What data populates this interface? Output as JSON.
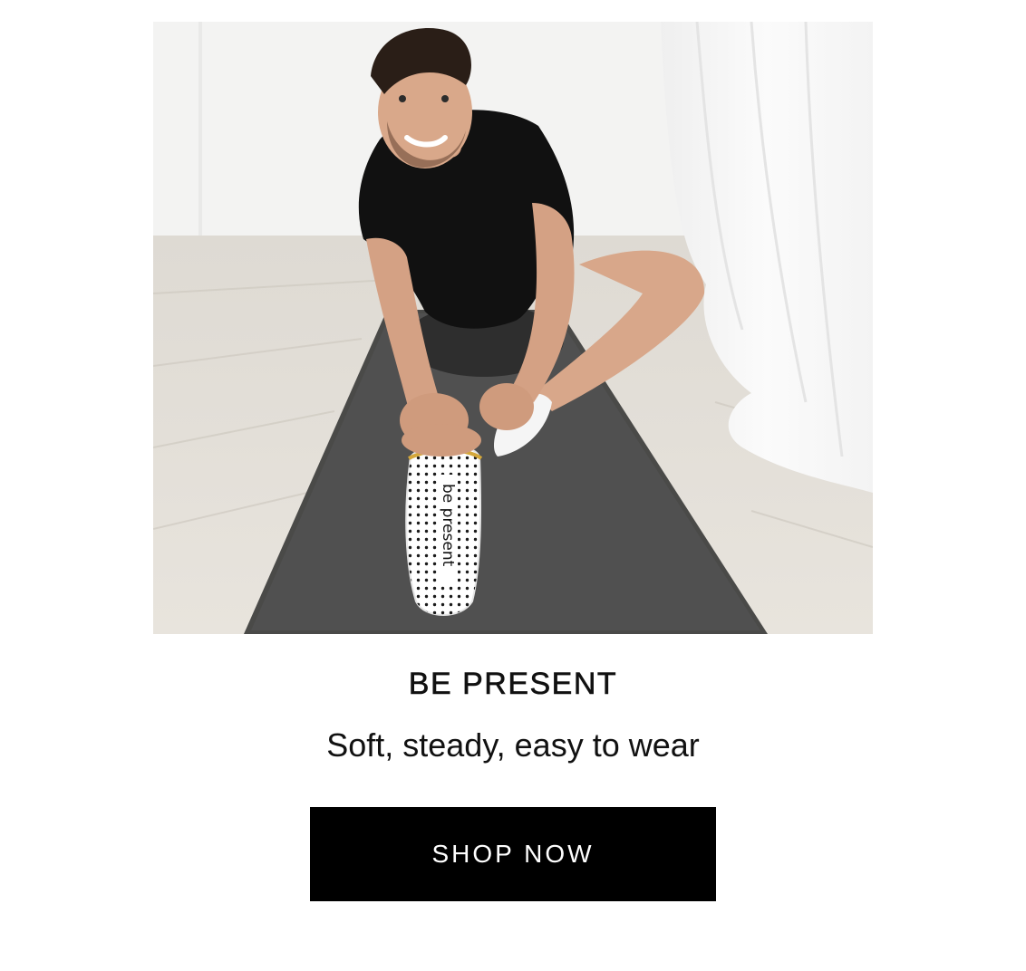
{
  "hero": {
    "sock_print": "be present"
  },
  "promo": {
    "headline": "BE PRESENT",
    "subheadline": "Soft, steady, easy to wear",
    "cta_label": "SHOP NOW"
  },
  "colors": {
    "cta_background": "#000000",
    "cta_text": "#ffffff",
    "text": "#111111"
  }
}
